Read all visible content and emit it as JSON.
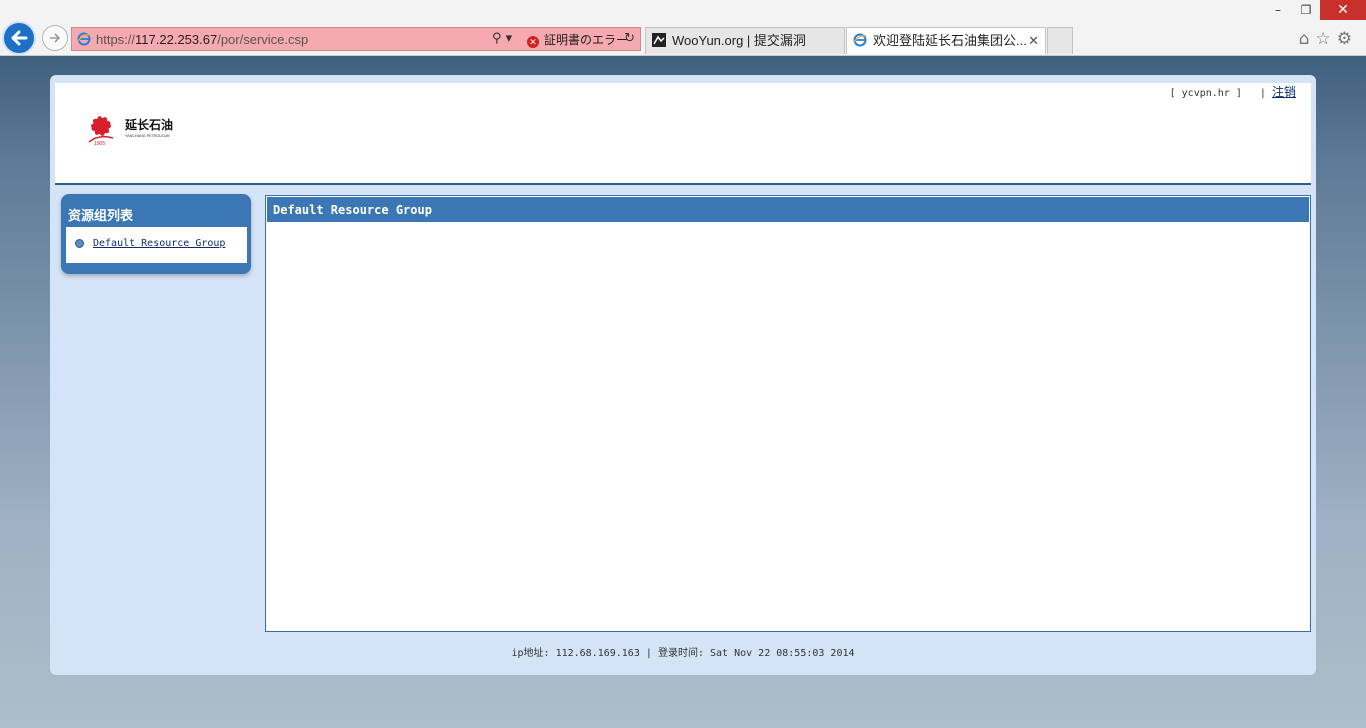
{
  "browser": {
    "window_controls": {
      "minimize": "–",
      "restore": "❐",
      "close": "✕"
    },
    "address": {
      "scheme": "https://",
      "host": "117.22.253.67",
      "path": "/por/service.csp",
      "cert_error": "証明書のエラー"
    },
    "tabs": [
      {
        "label": "WooYun.org | 提交漏洞"
      },
      {
        "label": "欢迎登陆延长石油集团公...",
        "close": "✕"
      }
    ],
    "toolbar_icons": [
      "home-icon",
      "star-icon",
      "gear-icon"
    ]
  },
  "header": {
    "user_text": "[ ycvpn.hr ]",
    "separator": "|",
    "logout_label": "注销",
    "logo": {
      "name": "延长石油",
      "sub": "YANCHANG PETROLEUM",
      "year": "1905"
    }
  },
  "sidebar": {
    "title": "资源组列表",
    "items": [
      {
        "label": "Default Resource Group"
      }
    ]
  },
  "main": {
    "title": "Default Resource Group"
  },
  "footer": {
    "ip_label": "ip地址:",
    "ip_value": "112.68.169.163",
    "sep": "|",
    "time_label": "登录时间:",
    "time_value": "Sat Nov 22 08:55:03 2014"
  },
  "colors": {
    "accent": "#3c77b5",
    "panel_bg": "#d4e4f6",
    "cert_error_bg": "#f6a9b0"
  }
}
